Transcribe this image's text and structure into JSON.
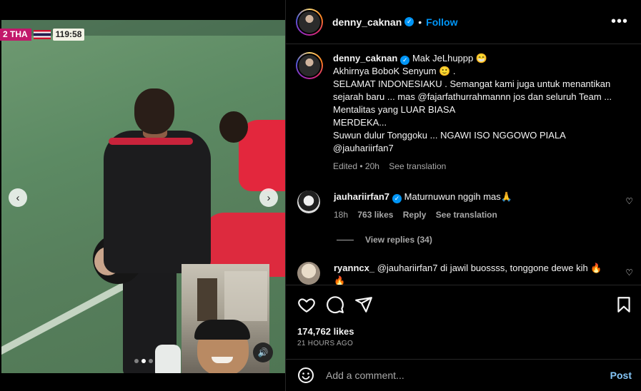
{
  "media": {
    "scorebug": {
      "score": "2 THA",
      "clock": "119:58"
    },
    "nav_prev": "‹",
    "nav_next": "›",
    "audio_icon": "🔊",
    "carousel_index": 2,
    "carousel_count": 3
  },
  "header": {
    "username": "denny_caknan",
    "separator": "•",
    "follow_label": "Follow",
    "more_label": "•••"
  },
  "caption": {
    "username": "denny_caknan",
    "lines": [
      "Mak JeLhuppp 😁",
      "Akhirnya BoboK Senyum 🙂 .",
      "SELAMAT INDONESIAKU . Semangat kami juga untuk menantikan sejarah baru ... mas @fajarfathurrahmannn jos dan seluruh Team ... Mentalitas yang LUAR BIASA",
      "MERDEKA...",
      "Suwun dulur Tonggoku ... NGAWI ISO NGGOWO PIALA",
      "@jauhariirfan7"
    ],
    "edited": "Edited • 20h",
    "see_translation": "See translation"
  },
  "comments": [
    {
      "username": "jauhariirfan7",
      "text": "Maturnuwun nggih mas🙏",
      "age": "18h",
      "likes": "763 likes",
      "reply": "Reply",
      "see_translation": "See translation",
      "view_replies": "View replies (34)"
    },
    {
      "username": "ryanncx_",
      "text": "@jauhariirfan7 di jawil buossss, tonggone dewe kih 🔥🔥"
    }
  ],
  "footer": {
    "likes": "174,762 likes",
    "posted": "21 HOURS AGO",
    "comment_placeholder": "Add a comment...",
    "post_label": "Post"
  },
  "colors": {
    "accent": "#0095f6",
    "background": "#000000",
    "muted": "#a8a8a8",
    "divider": "#262626"
  }
}
